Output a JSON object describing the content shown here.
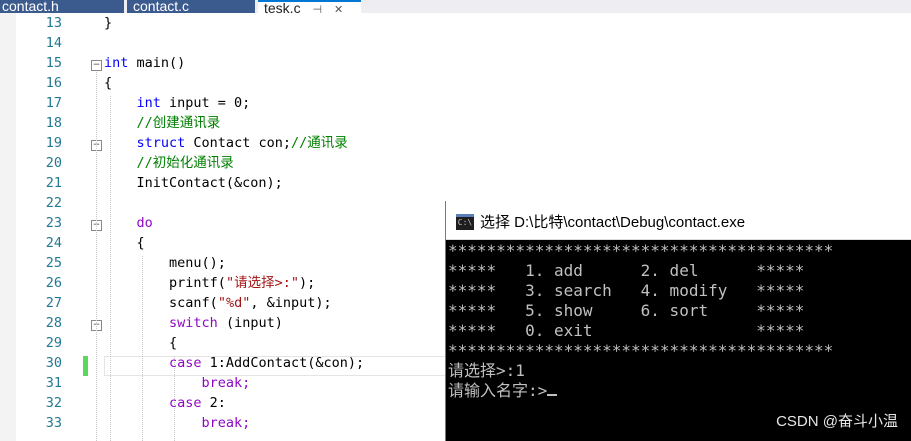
{
  "tabs": [
    {
      "label": "contact.h",
      "active": false
    },
    {
      "label": "contact.c",
      "active": false
    },
    {
      "label": "tesk.c",
      "active": true
    }
  ],
  "editor": {
    "line_numbers": [
      "13",
      "14",
      "15",
      "16",
      "17",
      "18",
      "19",
      "20",
      "21",
      "22",
      "23",
      "24",
      "25",
      "26",
      "27",
      "28",
      "29",
      "30",
      "31",
      "32",
      "33"
    ],
    "lines": {
      "l13": "}",
      "l15_kw": "int",
      "l15_rest": " main()",
      "l16": "{",
      "l17_kw": "int",
      "l17_rest": " input = 0;",
      "l18": "//创建通讯录",
      "l19_kw": "struct",
      "l19_rest": " Contact con;",
      "l19_cm": "//通讯录",
      "l20": "//初始化通讯录",
      "l21": "InitContact(&con);",
      "l23": "do",
      "l24": "{",
      "l25": "menu();",
      "l26_a": "printf(",
      "l26_str": "\"请选择>:\"",
      "l26_b": ");",
      "l27_a": "scanf(",
      "l27_str": "\"%d\"",
      "l27_b": ", &input);",
      "l28_kw": "switch",
      "l28_rest": " (input)",
      "l29": "{",
      "l30_kw": "case",
      "l30_rest": " 1:AddContact(&con);",
      "l31": "break;",
      "l32_kw": "case",
      "l32_rest": " 2:",
      "l33": "break;"
    }
  },
  "console": {
    "title": "选择 D:\\比特\\contact\\Debug\\contact.exe",
    "icon_text": "C:\\",
    "lines": [
      "****************************************",
      "*****   1. add      2. del      *****",
      "*****   3. search   4. modify   *****",
      "*****   5. show     6. sort     *****",
      "*****   0. exit                 *****",
      "****************************************",
      "请选择>:1",
      "请输入名字:>"
    ]
  },
  "watermark": "CSDN @奋斗小温",
  "icons": {
    "pin": "pin-icon",
    "close": "close-icon",
    "fold": "fold-minus-icon"
  }
}
